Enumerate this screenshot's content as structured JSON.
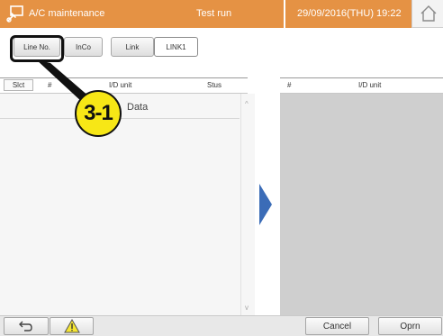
{
  "header": {
    "title": "A/C maintenance",
    "center": "Test run",
    "datetime": "29/09/2016(THU) 19:22",
    "icons": [
      "maintenance-icon",
      "home-icon"
    ]
  },
  "tabs": {
    "line_no": "Line No.",
    "inco": "InCo",
    "link": "Link",
    "link_value": "LINK1"
  },
  "left_list": {
    "col_select": "Slct",
    "col_number": "#",
    "col_unit": "I/D unit",
    "col_status": "Stus",
    "row_text": "Data"
  },
  "right_list": {
    "col_number": "#",
    "col_unit": "I/D unit"
  },
  "callout": {
    "label": "3-1"
  },
  "footer": {
    "cancel": "Cancel",
    "operation": "Oprn",
    "icons": [
      "back-icon",
      "warning-icon"
    ]
  },
  "colors": {
    "header_orange": "#e59244",
    "arrow_blue": "#3b6cb7",
    "callout_yellow": "#f7e716"
  }
}
